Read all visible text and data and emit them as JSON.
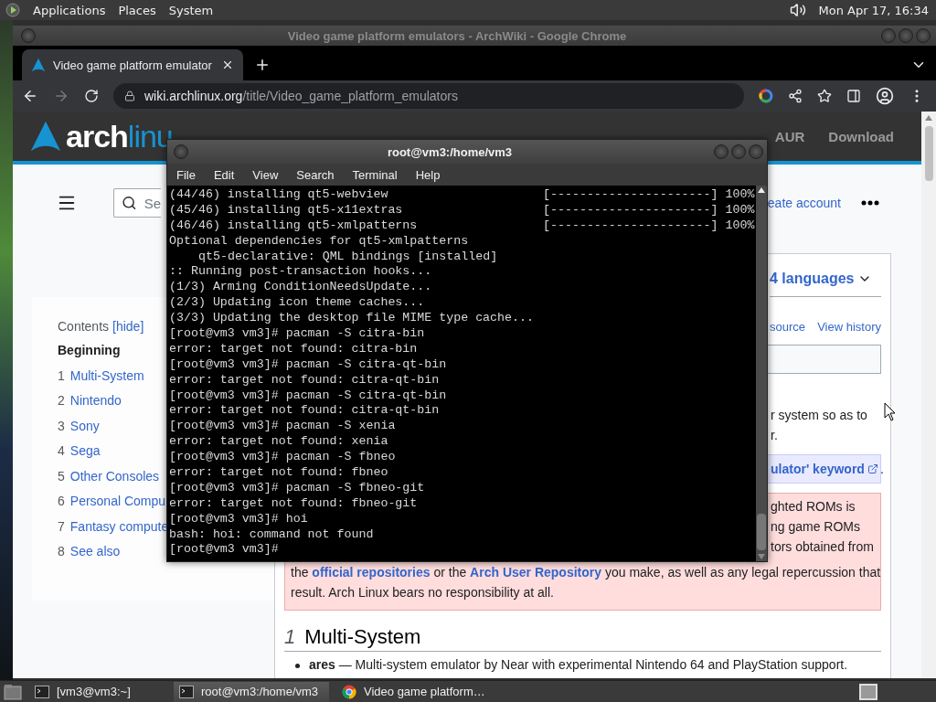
{
  "top_panel": {
    "menus": [
      "Applications",
      "Places",
      "System"
    ],
    "clock": "Mon Apr 17, 16:34"
  },
  "browser": {
    "title": "Video game platform emulators - ArchWiki - Google Chrome",
    "tabs": [
      {
        "title": "Video game platform emulator",
        "selected": true
      }
    ],
    "address": {
      "host": "wiki.archlinux.org",
      "path": "/title/Video_game_platform_emulators"
    }
  },
  "wiki": {
    "logo": {
      "bold": "arch",
      "light": "linu"
    },
    "nav": [
      "AUR",
      "Download"
    ],
    "search_placeholder": "Se",
    "account_link": "eate account",
    "toc": {
      "title": "Contents",
      "toggle": "[hide]",
      "items": [
        {
          "title": "Beginning",
          "selected": true
        },
        {
          "number": "1",
          "title": "Multi-System",
          "selected": false
        },
        {
          "number": "2",
          "title": "Nintendo",
          "selected": false
        },
        {
          "number": "3",
          "title": "Sony",
          "selected": false
        },
        {
          "number": "4",
          "title": "Sega",
          "selected": false
        },
        {
          "number": "5",
          "title": "Other Consoles",
          "selected": false
        },
        {
          "number": "6",
          "title": "Personal Compu",
          "selected": false
        },
        {
          "number": "7",
          "title": "Fantasy compute",
          "selected": false
        },
        {
          "number": "8",
          "title": "See also",
          "selected": false
        }
      ]
    },
    "languages": "4 languages",
    "page_links": [
      "source",
      "View history"
    ],
    "intro_fragments": [
      "r system so as to",
      "r."
    ],
    "note": {
      "link": "ulator' keyword",
      "tail": "."
    },
    "warning": {
      "fragments": [
        "ghted ROMs is",
        "ng game ROMs",
        "tors obtained from"
      ],
      "segments": [
        {
          "text": "the "
        },
        {
          "text": "official repositories",
          "link": true
        },
        {
          "text": " or the "
        },
        {
          "text": "Arch User Repository",
          "link": true
        },
        {
          "text": " you make, as well as any legal repercussion that"
        }
      ],
      "last_line": "result. Arch Linux bears no responsibility at all."
    },
    "section": {
      "number": "1",
      "title": "Multi-System"
    },
    "bullets": [
      {
        "text": "**ares** — Multi-system emulator by Near with experimental Nintendo 64 and PlayStation support."
      }
    ]
  },
  "terminal": {
    "title": "root@vm3:/home/vm3",
    "menus": [
      "File",
      "Edit",
      "View",
      "Search",
      "Terminal",
      "Help"
    ],
    "lines": [
      {
        "kind": "progress",
        "text": "(44/46) installing qt5-webview",
        "bar": "[----------------------]",
        "percent": "100%"
      },
      {
        "kind": "progress",
        "text": "(45/46) installing qt5-x11extras",
        "bar": "[----------------------]",
        "percent": "100%"
      },
      {
        "kind": "progress",
        "text": "(46/46) installing qt5-xmlpatterns",
        "bar": "[----------------------]",
        "percent": "100%"
      },
      {
        "kind": "plain",
        "text": "Optional dependencies for qt5-xmlpatterns"
      },
      {
        "kind": "indented",
        "text": "qt5-declarative: QML bindings [installed]"
      },
      {
        "kind": "plain",
        "text": ":: Running post-transaction hooks..."
      },
      {
        "kind": "plain",
        "text": "(1/3) Arming ConditionNeedsUpdate..."
      },
      {
        "kind": "plain",
        "text": "(2/3) Updating icon theme caches..."
      },
      {
        "kind": "plain",
        "text": "(3/3) Updating the desktop file MIME type cache..."
      },
      {
        "kind": "plain",
        "text": "[root@vm3 vm3]# pacman -S citra-bin"
      },
      {
        "kind": "plain",
        "text": "error: target not found: citra-bin"
      },
      {
        "kind": "plain",
        "text": "[root@vm3 vm3]# pacman -S citra-qt-bin"
      },
      {
        "kind": "plain",
        "text": "error: target not found: citra-qt-bin"
      },
      {
        "kind": "plain",
        "text": "[root@vm3 vm3]# pacman -S citra-qt-bin"
      },
      {
        "kind": "plain",
        "text": "error: target not found: citra-qt-bin"
      },
      {
        "kind": "plain",
        "text": "[root@vm3 vm3]# pacman -S xenia"
      },
      {
        "kind": "plain",
        "text": "error: target not found: xenia"
      },
      {
        "kind": "plain",
        "text": "[root@vm3 vm3]# pacman -S fbneo"
      },
      {
        "kind": "plain",
        "text": "error: target not found: fbneo"
      },
      {
        "kind": "plain",
        "text": "[root@vm3 vm3]# pacman -S fbneo-git"
      },
      {
        "kind": "plain",
        "text": "error: target not found: fbneo-git"
      },
      {
        "kind": "plain",
        "text": "[root@vm3 vm3]# hoi"
      },
      {
        "kind": "plain",
        "text": "bash: hoi: command not found"
      },
      {
        "kind": "plain",
        "text": "[root@vm3 vm3]#"
      }
    ]
  },
  "taskbar": {
    "items": [
      {
        "kind": "terminal",
        "label": "[vm3@vm3:~]",
        "selected": false
      },
      {
        "kind": "terminal",
        "label": "root@vm3:/home/vm3",
        "selected": true
      },
      {
        "kind": "browser",
        "label": "Video game platform…",
        "selected": false
      }
    ]
  }
}
